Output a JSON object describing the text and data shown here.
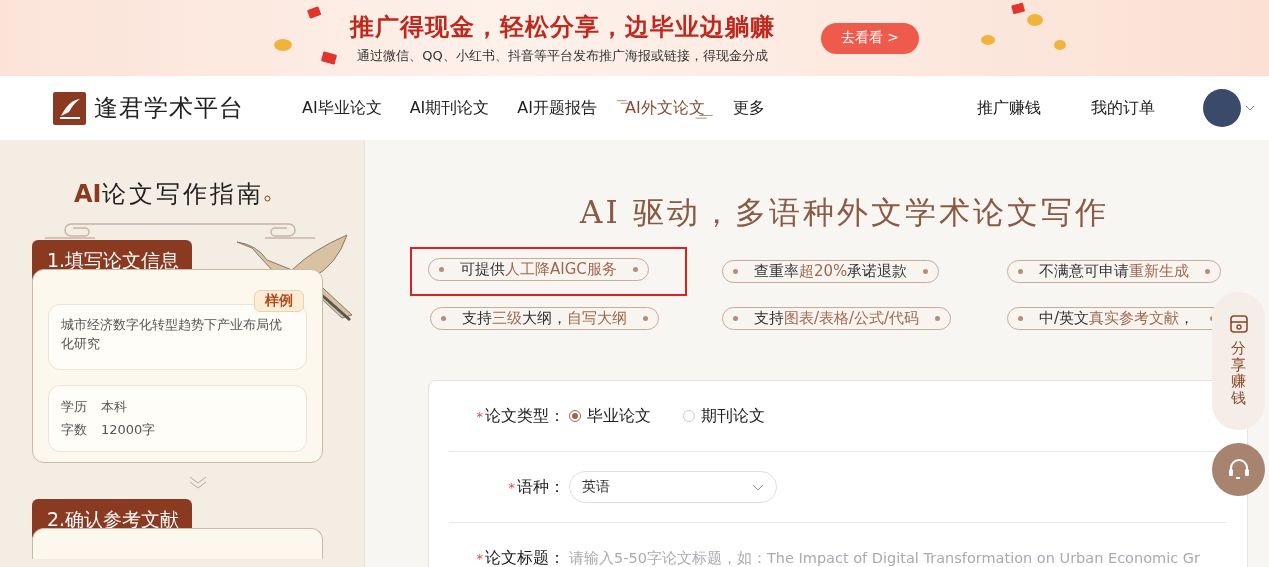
{
  "banner": {
    "headline": "推广得现金，轻松分享，边毕业边躺赚",
    "subtitle": "通过微信、QQ、小红书、抖音等平台发布推广海报或链接，得现金分成",
    "button": "去看看 >"
  },
  "nav": {
    "logo": "逢君学术平台",
    "items": [
      {
        "label": "AI毕业论文",
        "selected": false
      },
      {
        "label": "AI期刊论文",
        "selected": false
      },
      {
        "label": "AI开题报告",
        "selected": false
      },
      {
        "label": "AI外文论文",
        "selected": true
      },
      {
        "label": "更多",
        "selected": false
      }
    ],
    "right_links": [
      "推广赚钱",
      "我的订单"
    ]
  },
  "guide": {
    "title_accent": "AI",
    "title": "论文写作指南",
    "steps": [
      {
        "label": "1.填写论文信息",
        "badge": "样例",
        "topic": "城市经济数字化转型趋势下产业布局优化研究",
        "details": [
          {
            "key": "学历",
            "value": "本科"
          },
          {
            "key": "字数",
            "value": "12000字"
          }
        ]
      },
      {
        "label": "2.确认参考文献"
      }
    ]
  },
  "main": {
    "heading": "AI 驱动，多语种外文学术论文写作",
    "features": [
      {
        "marked": true,
        "segments": [
          {
            "text": "可提供",
            "highlight": false
          },
          {
            "text": "人工降AIGC服务",
            "highlight": true
          }
        ]
      },
      {
        "marked": false,
        "segments": [
          {
            "text": "查重率",
            "highlight": false
          },
          {
            "text": "超20%",
            "highlight": true
          },
          {
            "text": "承诺退款",
            "highlight": false
          }
        ]
      },
      {
        "marked": false,
        "segments": [
          {
            "text": "不满意可申请",
            "highlight": false
          },
          {
            "text": "重新生成",
            "highlight": true
          }
        ]
      },
      {
        "marked": false,
        "segments": [
          {
            "text": "支持",
            "highlight": false
          },
          {
            "text": "三级",
            "highlight": true
          },
          {
            "text": "大纲，",
            "highlight": false
          },
          {
            "text": "自写大纲",
            "highlight": true
          }
        ]
      },
      {
        "marked": false,
        "segments": [
          {
            "text": "支持",
            "highlight": false
          },
          {
            "text": "图表/表格/公式/代码",
            "highlight": true
          }
        ]
      },
      {
        "marked": false,
        "segments": [
          {
            "text": "中/英文",
            "highlight": false
          },
          {
            "text": "真实参考文献",
            "highlight": true
          },
          {
            "text": "，",
            "highlight": false
          }
        ]
      }
    ]
  },
  "form": {
    "required_mark": "*",
    "fields": [
      {
        "kind": "radio",
        "label": "论文类型：",
        "required": true,
        "options": [
          {
            "label": "毕业论文",
            "selected": true
          },
          {
            "label": "期刊论文",
            "selected": false
          }
        ]
      },
      {
        "kind": "select",
        "label": "语种：",
        "required": true,
        "value": "英语"
      },
      {
        "kind": "text",
        "label": "论文标题：",
        "required": true,
        "placeholder": "请输入5-50字论文标题，如：The Impact of Digital Transformation on Urban Economic Gr"
      }
    ]
  },
  "float": {
    "share": "分享赚钱"
  }
}
